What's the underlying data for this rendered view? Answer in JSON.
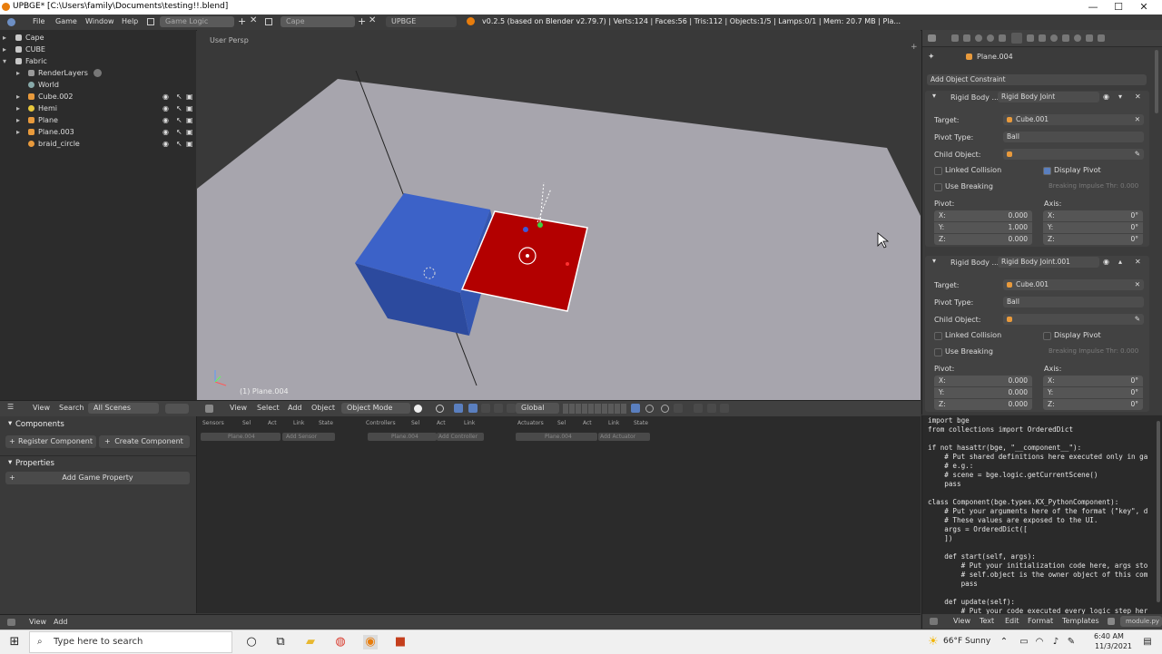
{
  "window": {
    "title": "UPBGE* [C:\\Users\\family\\Documents\\testing!!.blend]",
    "minimize": "—",
    "maximize": "☐",
    "close": "✕"
  },
  "info": {
    "menus": [
      "File",
      "Game",
      "Window",
      "Help"
    ],
    "screen_name": "Game Logic",
    "scene_name": "Cape",
    "engine": "UPBGE",
    "stats": "v0.2.5 (based on Blender v2.79.7) | Verts:124 | Faces:56 | Tris:112 | Objects:1/5 | Lamps:0/1 | Mem: 20.7 MB | Pla..."
  },
  "outliner": {
    "rows": [
      {
        "label": "Cape",
        "icon": "scene-icon"
      },
      {
        "label": "CUBE",
        "icon": "scene-icon"
      },
      {
        "label": "Fabric",
        "icon": "scene-icon"
      },
      {
        "label": "RenderLayers",
        "icon": "render-layers-icon"
      },
      {
        "label": "World",
        "icon": "world-icon"
      },
      {
        "label": "Cube.002",
        "icon": "mesh-object-icon"
      },
      {
        "label": "Hemi",
        "icon": "lamp-icon"
      },
      {
        "label": "Plane",
        "icon": "mesh-object-icon"
      },
      {
        "label": "Plane.003",
        "icon": "mesh-object-icon"
      },
      {
        "label": "braid_circle",
        "icon": "curve-object-icon"
      }
    ]
  },
  "viewport": {
    "view_label": "User Persp",
    "object_label": "(1) Plane.004"
  },
  "view_header": {
    "menus": [
      "View",
      "Select",
      "Add",
      "Object"
    ],
    "mode": "Object Mode",
    "orientation": "Global",
    "left_menus": [
      "View",
      "Search"
    ],
    "scenes": "All Scenes"
  },
  "logic_left": {
    "components_title": "Components",
    "register_label": "Register Component",
    "create_label": "Create Component",
    "properties_title": "Properties",
    "add_property_label": "Add Game Property"
  },
  "logic_bricks": {
    "sensors": {
      "title": "Sensors",
      "opts": [
        "Sel",
        "Act",
        "Link",
        "State"
      ],
      "object": "Plane.004",
      "add": "Add Sensor"
    },
    "controllers": {
      "title": "Controllers",
      "opts": [
        "Sel",
        "Act",
        "Link"
      ],
      "object": "Plane.004",
      "add": "Add Controller"
    },
    "actuators": {
      "title": "Actuators",
      "opts": [
        "Sel",
        "Act",
        "Link",
        "State"
      ],
      "object": "Plane.004",
      "add": "Add Actuator"
    }
  },
  "bottom_bar": {
    "menus": [
      "View",
      "Add"
    ]
  },
  "properties": {
    "context": "Plane.004",
    "add_constraint": "Add Object Constraint",
    "constraints": [
      {
        "type": "Rigid Body ...",
        "name": "Rigid Body Joint",
        "target_label": "Target:",
        "target": "Cube.001",
        "pivot_type_label": "Pivot Type:",
        "pivot_type": "Ball",
        "child_label": "Child Object:",
        "linked_collision": "Linked Collision",
        "display_pivot": "Display Pivot",
        "use_breaking": "Use Breaking",
        "breaking_impulse": "Breaking Impulse Thr: 0.000",
        "pivot_title": "Pivot:",
        "axis_title": "Axis:",
        "pivot": [
          {
            "k": "X:",
            "v": "0.000"
          },
          {
            "k": "Y:",
            "v": "1.000"
          },
          {
            "k": "Z:",
            "v": "0.000"
          }
        ],
        "axis": [
          {
            "k": "X:",
            "v": "0°"
          },
          {
            "k": "Y:",
            "v": "0°"
          },
          {
            "k": "Z:",
            "v": "0°"
          }
        ],
        "display_pivot_checked": true
      },
      {
        "type": "Rigid Body ...",
        "name": "Rigid Body Joint.001",
        "target_label": "Target:",
        "target": "Cube.001",
        "pivot_type_label": "Pivot Type:",
        "pivot_type": "Ball",
        "child_label": "Child Object:",
        "linked_collision": "Linked Collision",
        "display_pivot": "Display Pivot",
        "use_breaking": "Use Breaking",
        "breaking_impulse": "Breaking Impulse Thr: 0.000",
        "pivot_title": "Pivot:",
        "axis_title": "Axis:",
        "pivot": [
          {
            "k": "X:",
            "v": "0.000"
          },
          {
            "k": "Y:",
            "v": "0.000"
          },
          {
            "k": "Z:",
            "v": "0.000"
          }
        ],
        "axis": [
          {
            "k": "X:",
            "v": "0°"
          },
          {
            "k": "Y:",
            "v": "0°"
          },
          {
            "k": "Z:",
            "v": "0°"
          }
        ],
        "display_pivot_checked": false
      }
    ]
  },
  "text_editor": {
    "code": "import bge\nfrom collections import OrderedDict\n\nif not hasattr(bge, \"__component__\"):\n    # Put shared definitions here executed only in ga\n    # e.g.:\n    # scene = bge.logic.getCurrentScene()\n    pass\n\nclass Component(bge.types.KX_PythonComponent):\n    # Put your arguments here of the format (\"key\", d\n    # These values are exposed to the UI.\n    args = OrderedDict([\n    ])\n\n    def start(self, args):\n        # Put your initialization code here, args sto\n        # self.object is the owner object of this com\n        pass\n\n    def update(self):\n        # Put your code executed every logic step her",
    "menus": [
      "View",
      "Text",
      "Edit",
      "Format",
      "Templates"
    ],
    "filename": "module.py"
  },
  "taskbar": {
    "search_placeholder": "Type here to search",
    "weather": "66°F  Sunny",
    "time": "6:40 AM",
    "date": "11/3/2021"
  }
}
